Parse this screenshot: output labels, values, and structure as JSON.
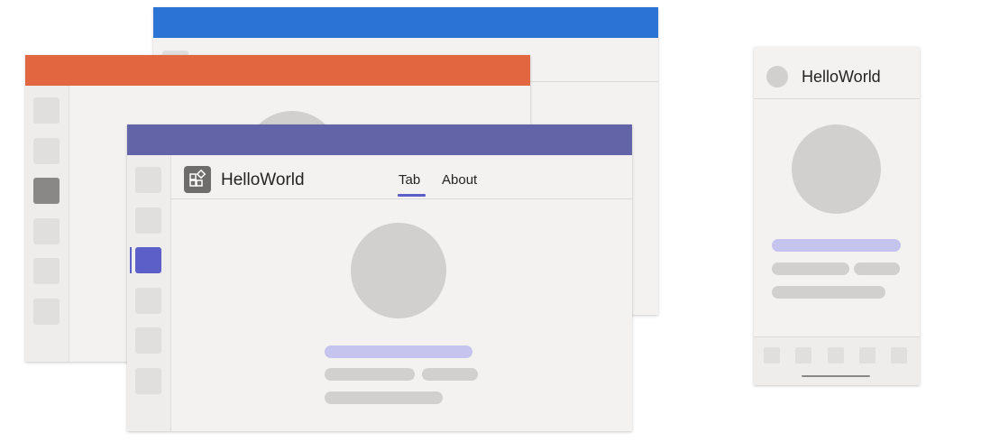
{
  "app": {
    "title": "HelloWorld",
    "icon": "apps-icon"
  },
  "tabs": [
    {
      "label": "Tab",
      "active": true
    },
    {
      "label": "About",
      "active": false
    }
  ],
  "mobile": {
    "title": "HelloWorld"
  },
  "colors": {
    "blue_titlebar": "#2b74d6",
    "orange_titlebar": "#e26640",
    "purple_titlebar": "#6264a7",
    "rail_active": "#5b5fc7",
    "rail_selected_gray": "#8a8886",
    "placeholder": "#d2d0ce",
    "accent_placeholder": "#c5c4ee"
  }
}
